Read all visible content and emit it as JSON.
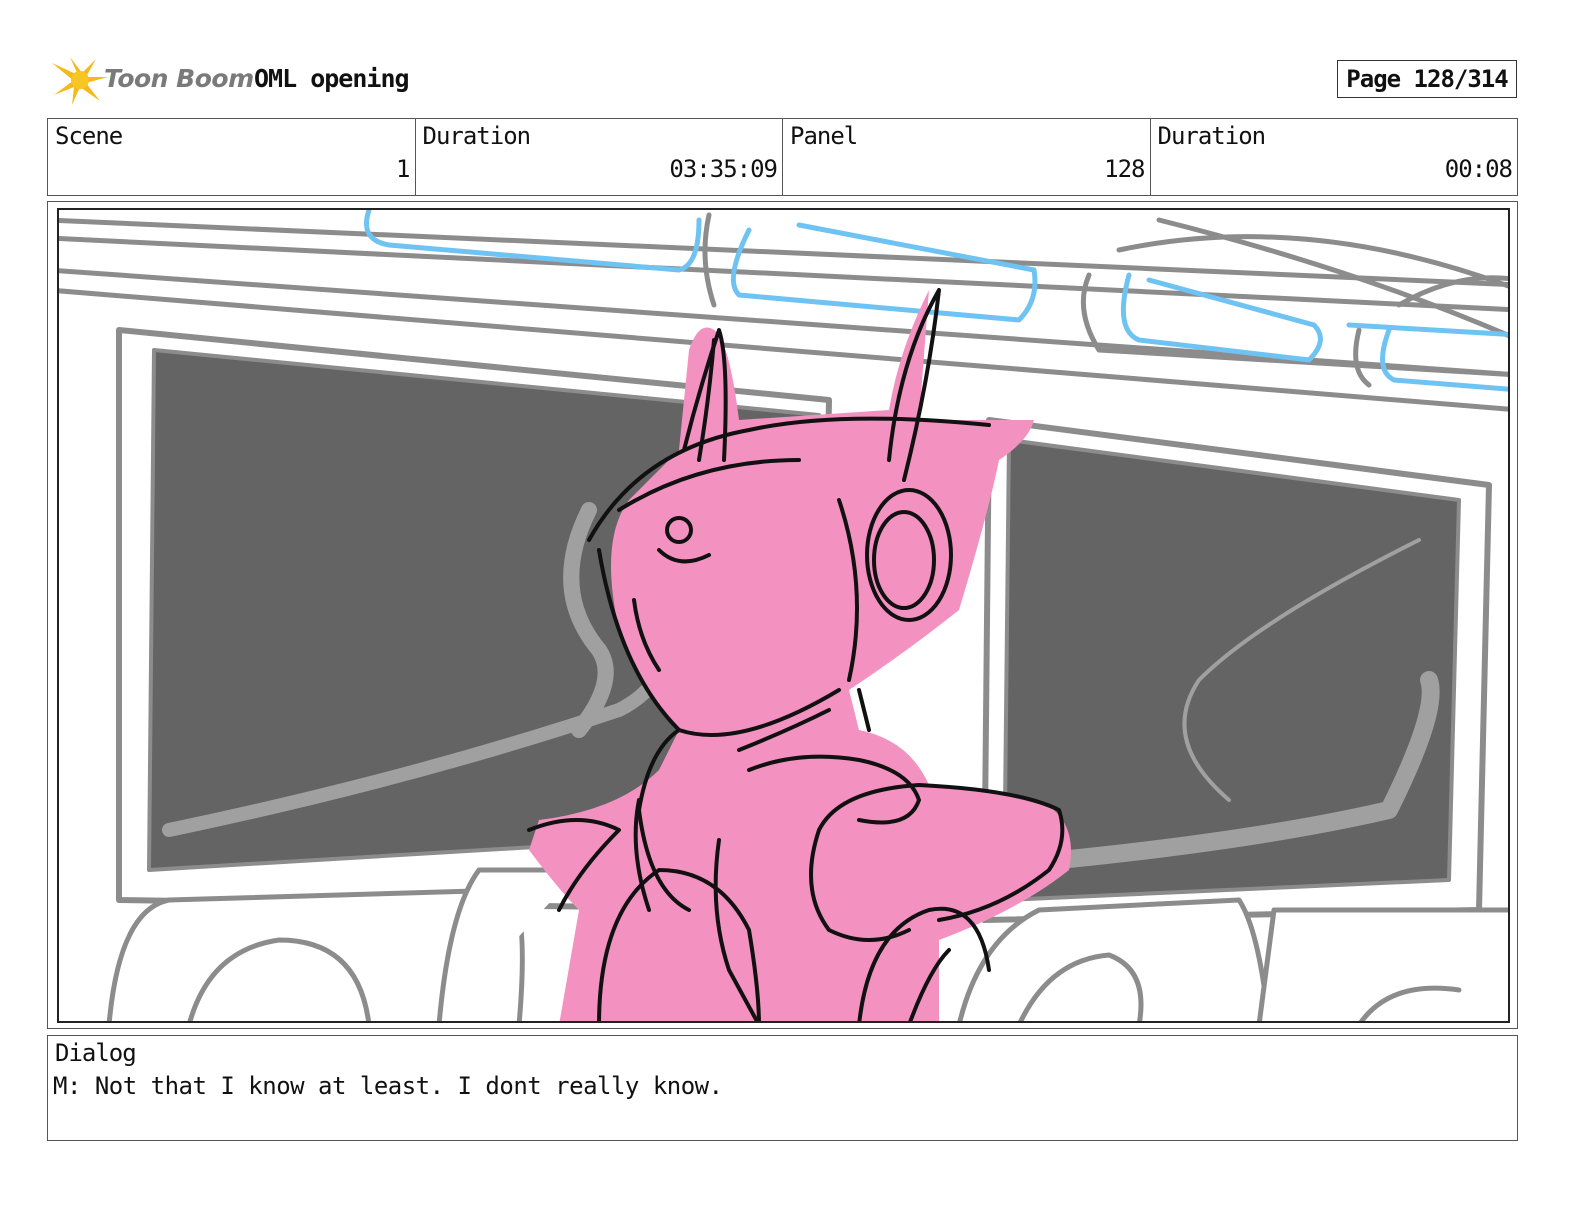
{
  "header": {
    "brand": "Toon Boom",
    "project_title": "OML opening",
    "page_label": "Page 128/314"
  },
  "info": {
    "scene_label": "Scene",
    "scene_value": "1",
    "duration_label": "Duration",
    "duration_value": "03:35:09",
    "panel_label": "Panel",
    "panel_value": "128",
    "panel_duration_label": "Duration",
    "panel_duration_value": "00:08"
  },
  "dialog": {
    "label": "Dialog",
    "text": "M: Not that I know at least. I dont really know."
  },
  "colors": {
    "character_pink": "#f392c0",
    "screen_dark": "#646464",
    "sketch_gray": "#8c8c8c",
    "sketch_blue": "#6ec3f2"
  }
}
